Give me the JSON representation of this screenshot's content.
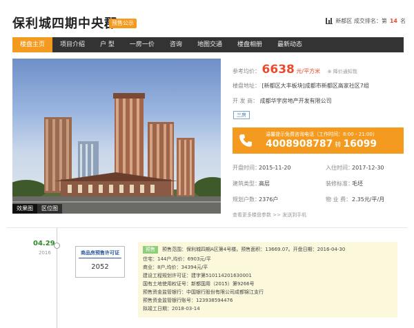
{
  "header": {
    "title": "保利城四期中央郡",
    "presale_tag": "预售公示",
    "rank_prefix": "新都区 成交排名：第",
    "rank_num": "14",
    "rank_suffix": "名"
  },
  "nav": {
    "items": [
      "楼盘主页",
      "项目介绍",
      "户 型",
      "一房一价",
      "咨询",
      "地图交通",
      "楼盘相册",
      "最新动态"
    ]
  },
  "hero": {
    "tabs": [
      "效果图",
      "区位图"
    ]
  },
  "info": {
    "price_label": "参考均价：",
    "price_value": "6638",
    "price_unit": "元/平方米",
    "price_notify": "降价通知我",
    "address_label": "楼盘地址：",
    "address_value": "[新都区大丰板块]成都市新都区高家社区7组",
    "developer_label": "开 发 商：",
    "developer_value": "成都华宇房地产开发有限公司",
    "badge": "三房",
    "phone_hint": "温馨提示免费咨询电话（工作时间：8:00 - 21:00）",
    "phone_main": "4008908787",
    "phone_turn": "转",
    "phone_ext": "16099",
    "open_label": "开盘时间：",
    "open_value": "2015-11-20",
    "move_label": "入住时间：",
    "move_value": "2017-12-30",
    "type_label": "建筑类型：",
    "type_value": "高层",
    "deco_label": "装修标准：",
    "deco_value": "毛坯",
    "households_label": "规划户数：",
    "households_value": "2376户",
    "fee_label": "物 业 费：",
    "fee_value": "2.35元/平/月",
    "more_link": "查看更多楼盘参数",
    "sep": ">>",
    "send_link": "发送到手机"
  },
  "timeline": {
    "date": "04.29",
    "year": "2016",
    "cert_title": "商品房预售许可证",
    "cert_num": "2052",
    "presale_label": "预售",
    "line1": "预售范围：保利城四期A区第4号楼。预售面积：13669.07。开盘日期：2016-04-30",
    "line2": "住宅：144户,均价：6903元/平",
    "line3": "商业：8户,均价：34394元/平",
    "line4": "建设工程规划许可证：建字第510114201630001",
    "line5": "国有土地使用权证号：新都国用（2015）第9266号",
    "line6": "预售资金监管银行：中国银行股份有限公司成都锦江支行",
    "line7": "预售资金监管银行账号：123938594476",
    "line8": "拟竣工日期：2018-03-14"
  }
}
